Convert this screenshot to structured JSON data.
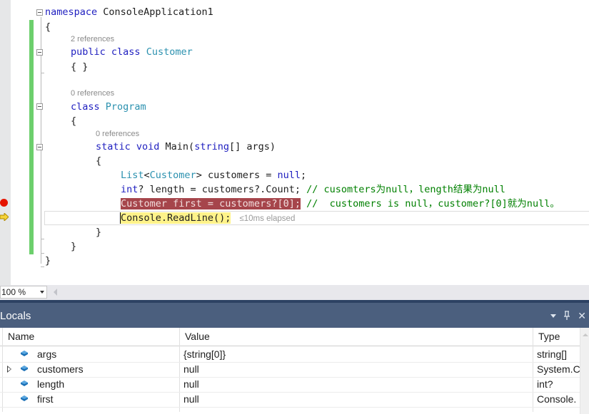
{
  "editor": {
    "lines": {
      "namespace_kw": "namespace",
      "namespace_name": " ConsoleApplication1",
      "open_ns": "{",
      "customer_refs": "2 references",
      "customer_public": "public",
      "customer_class": " class ",
      "customer_name": "Customer",
      "customer_body": "{ }",
      "program_refs": "0 references",
      "program_class": "class",
      "program_name": " Program",
      "program_open": "{",
      "main_refs": "0 references",
      "main_static": "static",
      "main_void": " void",
      "main_sig_a": " Main(",
      "main_string": "string",
      "main_sig_b": "[] args)",
      "main_open": "{",
      "l1_list": "List",
      "l1_lt": "<",
      "l1_customer": "Customer",
      "l1_rest": "> customers = ",
      "l1_null": "null",
      "l1_semi": ";",
      "l2_int": "int",
      "l2_rest": "? length = customers?.Count; ",
      "l2_comment": "// cusomters为null，length结果为null",
      "l3_code": "Customer first = customers?[0];",
      "l3_comment": " //  customers is null，customer?[0]就为null。",
      "l4_code": "Console.ReadLine();",
      "l4_elapsed": "≤10ms elapsed",
      "main_close": "}",
      "program_close": "}",
      "ns_close": "}"
    }
  },
  "zoom": {
    "value": "100 %"
  },
  "locals": {
    "title": "Locals",
    "buttons": {
      "dropdown": "dropdown-icon",
      "pin": "pin-icon",
      "close": "✕"
    },
    "columns": [
      "Name",
      "Value",
      "Type"
    ],
    "rows": [
      {
        "name": "args",
        "value": "{string[0]}",
        "type": "string[]",
        "expandable": false
      },
      {
        "name": "customers",
        "value": "null",
        "type": "System.C",
        "expandable": true
      },
      {
        "name": "length",
        "value": "null",
        "type": "int?",
        "expandable": false
      },
      {
        "name": "first",
        "value": "null",
        "type": "Console.",
        "expandable": false
      }
    ]
  },
  "colors": {
    "keyword": "#2020c0",
    "type": "#2b91af",
    "comment": "#008000",
    "breakpoint_highlight": "#a6454b",
    "current_statement": "#fff38a",
    "panel_title": "#4b5f7e"
  }
}
